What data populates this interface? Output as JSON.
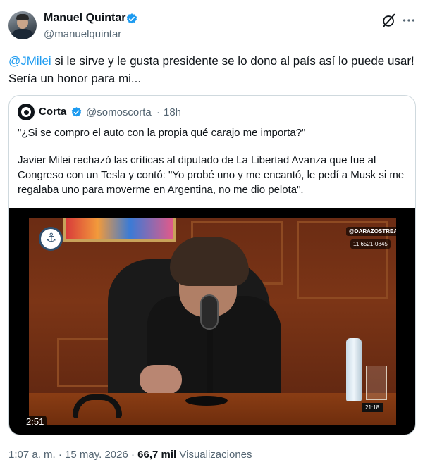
{
  "colors": {
    "accent": "#1d9bf0",
    "text": "#0f1419",
    "muted": "#536471",
    "border": "#cfd9de"
  },
  "author": {
    "name": "Manuel Quintar",
    "handle": "@manuelquintar",
    "verified": true,
    "avatar_icon": "person-avatar"
  },
  "header_actions": {
    "grok_icon": "grok-icon",
    "more_icon": "more-dots-icon",
    "more_label": "···"
  },
  "tweet": {
    "mention": "@JMilei",
    "text": " si le sirve y le gusta presidente se lo dono al país así lo puede usar! Sería un honor para mi..."
  },
  "quote": {
    "name": "Corta",
    "handle": "@somoscorta",
    "separator": "·",
    "time": "18h",
    "verified": true,
    "logo_icon": "corta-logo-icon",
    "line1": "\"¿Si se compro el auto con la propia qué carajo me importa?\"",
    "line2": "Javier Milei rechazó las críticas al diputado de La Libertad Avanza que fue al Congreso con un Tesla y contó: \"Yo probé uno y me encantó, le pedí a Musk si me regalaba uno para moverme en Argentina, no me dio pelota\".",
    "video": {
      "duration": "2:51",
      "watermark_channel": "@DARAZOSTREAM",
      "watermark_phone": "11 6521-0845",
      "clock": "21:18"
    }
  },
  "meta": {
    "time": "1:07 a. m.",
    "separator": " · ",
    "date": "15 may. 2026",
    "views_count": "66,7 mil",
    "views_label": " Visualizaciones"
  }
}
